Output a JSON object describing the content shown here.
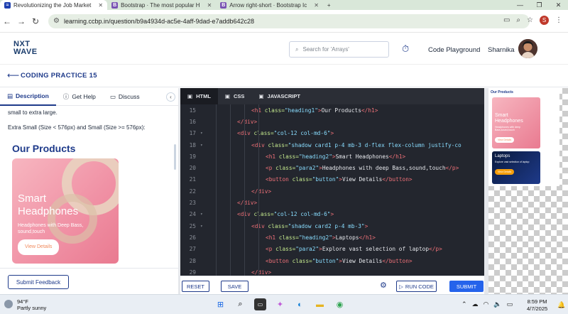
{
  "browser": {
    "tabs": [
      {
        "title": "Revolutionizing the Job Market",
        "icon": "ccbp-favicon-icon",
        "active": true
      },
      {
        "title": "Bootstrap · The most popular H",
        "icon": "bootstrap-favicon-icon",
        "active": false
      },
      {
        "title": "Arrow right-short · Bootstrap Ic",
        "icon": "bootstrap-favicon-icon",
        "active": false
      }
    ],
    "new_tab": "+",
    "url": "learning.ccbp.in/question/b9a4934d-ac5e-4aff-9dad-e7addb642c28",
    "profile_initial": "S"
  },
  "header": {
    "logo_line1": "NXT",
    "logo_line2": "WAVE",
    "search_placeholder": "Search for 'Arrays'",
    "code_playground": "Code Playground",
    "user_name": "Sharnika"
  },
  "subheader": {
    "title": "CODING PRACTICE 15"
  },
  "left_panel": {
    "tabs": [
      "Description",
      "Get Help",
      "Discuss"
    ],
    "text_line1": "small to extra large.",
    "text_line2": "Extra Small (Size < 576px) and Small (Size >= 576px):",
    "preview": {
      "heading": "Our Products",
      "card_title_1": "Smart",
      "card_title_2": "Headphones",
      "card_sub_1": "Headphones with Deep Bass,",
      "card_sub_2": "sound,touch",
      "card_button": "View Details"
    },
    "feedback_button": "Submit Feedback"
  },
  "editor": {
    "tabs": [
      "HTML",
      "CSS",
      "JAVASCRIPT"
    ],
    "lines": [
      {
        "n": "15",
        "fold": "",
        "indent": 3,
        "parts": [
          [
            "tg",
            "<h1 "
          ],
          [
            "at",
            "class="
          ],
          [
            "st",
            "\"heading1\""
          ],
          [
            "tg",
            ">"
          ],
          [
            "tx",
            "Our Products"
          ],
          [
            "tg",
            "</h1>"
          ]
        ]
      },
      {
        "n": "16",
        "fold": "",
        "indent": 2,
        "parts": [
          [
            "tg",
            "</div>"
          ]
        ]
      },
      {
        "n": "17",
        "fold": "▾",
        "indent": 2,
        "parts": [
          [
            "tg",
            "<div "
          ],
          [
            "at",
            "class="
          ],
          [
            "st",
            "\"col-12 col-md-6\""
          ],
          [
            "tg",
            ">"
          ]
        ]
      },
      {
        "n": "18",
        "fold": "▾",
        "indent": 3,
        "parts": [
          [
            "tg",
            "<div "
          ],
          [
            "at",
            "class="
          ],
          [
            "st",
            "\"shadow card1 p-4 mb-3 d-flex flex-column justify-co"
          ]
        ]
      },
      {
        "n": "19",
        "fold": "",
        "indent": 4,
        "parts": [
          [
            "tg",
            "<h1 "
          ],
          [
            "at",
            "class="
          ],
          [
            "st",
            "\"heading2\""
          ],
          [
            "tg",
            ">"
          ],
          [
            "tx",
            "Smart Headphones"
          ],
          [
            "tg",
            "</h1>"
          ]
        ]
      },
      {
        "n": "20",
        "fold": "",
        "indent": 4,
        "parts": [
          [
            "tg",
            "<p "
          ],
          [
            "at",
            "class="
          ],
          [
            "st",
            "\"para2\""
          ],
          [
            "tg",
            ">"
          ],
          [
            "tx",
            "Headphones with deep Bass,sound,touch"
          ],
          [
            "tg",
            "</p>"
          ]
        ]
      },
      {
        "n": "21",
        "fold": "",
        "indent": 4,
        "parts": [
          [
            "tg",
            "<button "
          ],
          [
            "at",
            "class="
          ],
          [
            "st",
            "\"button\""
          ],
          [
            "tg",
            ">"
          ],
          [
            "tx",
            "View Details"
          ],
          [
            "tg",
            "</button>"
          ]
        ]
      },
      {
        "n": "22",
        "fold": "",
        "indent": 3,
        "parts": [
          [
            "tg",
            "</div>"
          ]
        ]
      },
      {
        "n": "23",
        "fold": "",
        "indent": 2,
        "parts": [
          [
            "tg",
            "</div>"
          ]
        ]
      },
      {
        "n": "24",
        "fold": "▾",
        "indent": 2,
        "parts": [
          [
            "tg",
            "<div "
          ],
          [
            "at",
            "class="
          ],
          [
            "st",
            "\"col-12 col-md-6\""
          ],
          [
            "tg",
            ">"
          ]
        ]
      },
      {
        "n": "25",
        "fold": "▾",
        "indent": 3,
        "parts": [
          [
            "tg",
            "<div "
          ],
          [
            "at",
            "class="
          ],
          [
            "st",
            "\"shadow card2 p-4 mb-3\""
          ],
          [
            "tg",
            ">"
          ]
        ]
      },
      {
        "n": "26",
        "fold": "",
        "indent": 4,
        "parts": [
          [
            "tg",
            "<h1 "
          ],
          [
            "at",
            "class="
          ],
          [
            "st",
            "\"heading2\""
          ],
          [
            "tg",
            ">"
          ],
          [
            "tx",
            "Laptops"
          ],
          [
            "tg",
            "</h1>"
          ]
        ]
      },
      {
        "n": "27",
        "fold": "",
        "indent": 4,
        "parts": [
          [
            "tg",
            "<p "
          ],
          [
            "at",
            "class="
          ],
          [
            "st",
            "\"para2\""
          ],
          [
            "tg",
            ">"
          ],
          [
            "tx",
            "Explore vast selection of laptop"
          ],
          [
            "tg",
            "</p>"
          ]
        ]
      },
      {
        "n": "28",
        "fold": "",
        "indent": 4,
        "parts": [
          [
            "tg",
            "<button "
          ],
          [
            "at",
            "class="
          ],
          [
            "st",
            "\"button\""
          ],
          [
            "tg",
            ">"
          ],
          [
            "tx",
            "View Details"
          ],
          [
            "tg",
            "</button>"
          ]
        ]
      },
      {
        "n": "29",
        "fold": "",
        "indent": 3,
        "parts": [
          [
            "tg",
            "</div>"
          ]
        ]
      }
    ],
    "buttons": {
      "reset": "RESET",
      "save": "SAVE",
      "run": "RUN CODE",
      "submit": "SUBMIT"
    }
  },
  "preview_pane": {
    "heading": "Our Products",
    "card1_title_1": "Smart",
    "card1_title_2": "Headphones",
    "card1_sub": "Headphones with deep Bass,sound,touch",
    "card1_button": "View Details",
    "card2_title": "Laptops",
    "card2_sub": "Explore vast selection of laptop",
    "card2_button": "View Details"
  },
  "taskbar": {
    "temp": "94°F",
    "weather": "Partly sunny",
    "time": "8:59 PM",
    "date": "4/7/2025"
  },
  "colors": {
    "brand_blue": "#1e3a8a",
    "submit_blue": "#2563eb",
    "editor_bg": "#23262e"
  }
}
